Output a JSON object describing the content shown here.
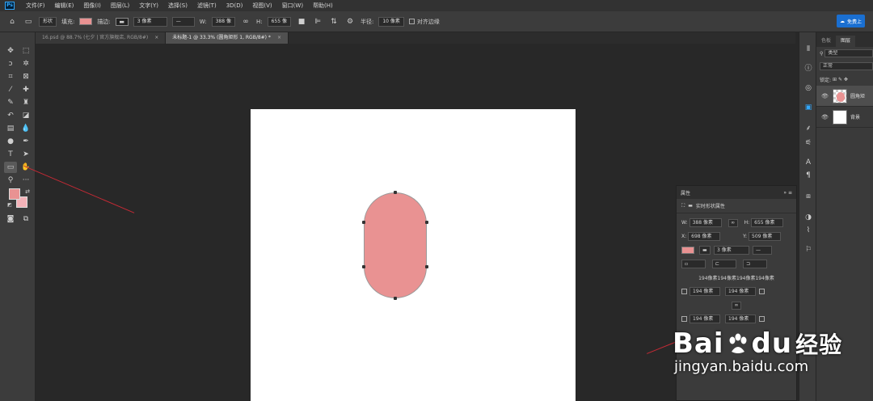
{
  "app": {
    "logo": "Ps"
  },
  "menu": [
    "文件(F)",
    "编辑(E)",
    "图像(I)",
    "图层(L)",
    "文字(Y)",
    "选择(S)",
    "滤镜(T)",
    "3D(D)",
    "视图(V)",
    "窗口(W)",
    "帮助(H)"
  ],
  "options": {
    "mode": "形状",
    "fill_label": "填充:",
    "stroke_label": "描边:",
    "stroke_width": "3 像素",
    "w_label": "W:",
    "w_value": "388 像",
    "h_label": "H:",
    "h_value": "655 像",
    "radius_label": "半径:",
    "radius_value": "10 像素",
    "align_edges": "对齐边缘",
    "cloud_label": "免费上"
  },
  "tabs": [
    {
      "label": "16.psd @ 88.7% (七夕 | 官方旗舰店, RGB/8#)",
      "active": false
    },
    {
      "label": "未标题-1 @ 33.3% (圆角矩形 1, RGB/8#) *",
      "active": true
    }
  ],
  "layers_panel": {
    "tabs": [
      "色板",
      "图层"
    ],
    "filter": "类型",
    "blend": "正常",
    "lock_label": "锁定:",
    "layers": [
      {
        "name": "圆角矩",
        "selected": true
      },
      {
        "name": "背景",
        "selected": false
      }
    ]
  },
  "properties": {
    "title": "属性",
    "subtitle": "实时形状属性",
    "w_label": "W:",
    "w_value": "388 像素",
    "h_label": "H:",
    "h_value": "655 像素",
    "x_label": "X:",
    "x_value": "698 像素",
    "y_label": "Y:",
    "y_value": "509 像素",
    "stroke_width": "3 像素",
    "corner_values": "194像素194像素194像素194像素",
    "corner_tl": "194 像素",
    "corner_tr": "194 像素",
    "corner_bl": "194 像素",
    "corner_br": "194 像素"
  },
  "colors": {
    "shape_fill": "#e99292",
    "foreground": "#e99292",
    "background": "#f3b2b8",
    "annotation": "#c42a35"
  },
  "watermark": {
    "top_a": "Bai",
    "top_b": "du",
    "top_c": "经验",
    "bottom": "jingyan.baidu.com"
  }
}
